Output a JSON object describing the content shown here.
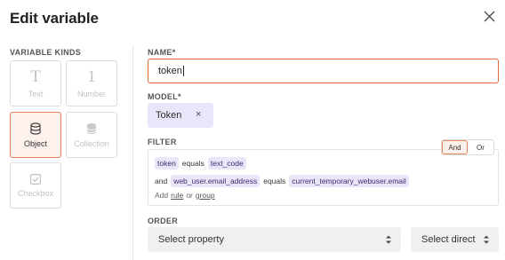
{
  "dialog": {
    "title": "Edit variable"
  },
  "kinds": {
    "label": "VARIABLE KINDS",
    "items": [
      {
        "label": "Text",
        "glyph": "T",
        "icon": "text-icon",
        "active": false
      },
      {
        "label": "Number",
        "glyph": "1",
        "icon": "number-icon",
        "active": false
      },
      {
        "label": "Object",
        "icon": "database-icon",
        "active": true
      },
      {
        "label": "Collection",
        "icon": "collection-stack-icon",
        "active": false
      },
      {
        "label": "Checkbox",
        "icon": "checkbox-icon",
        "active": false
      }
    ]
  },
  "name": {
    "label": "NAME*",
    "value": "token"
  },
  "model": {
    "label": "MODEL*",
    "value": "Token",
    "remove_glyph": "×"
  },
  "filter": {
    "label": "FILTER",
    "combinator_options": [
      "And",
      "Or"
    ],
    "combinator_selected": "And",
    "conditions": [
      {
        "prefix": "",
        "field": "token",
        "op": "equals",
        "value": "text_code"
      },
      {
        "prefix": "and",
        "field": "web_user.email_address",
        "op": "equals",
        "value": "current_temporary_webuser.email"
      }
    ],
    "add": {
      "prefix": "Add",
      "rule": "rule",
      "or": "or",
      "group": "group"
    }
  },
  "order": {
    "label": "ORDER",
    "property_placeholder": "Select property",
    "direction_placeholder": "Select direct"
  },
  "colors": {
    "accent": "#e46a3b",
    "chip": "#ebe5f9"
  }
}
